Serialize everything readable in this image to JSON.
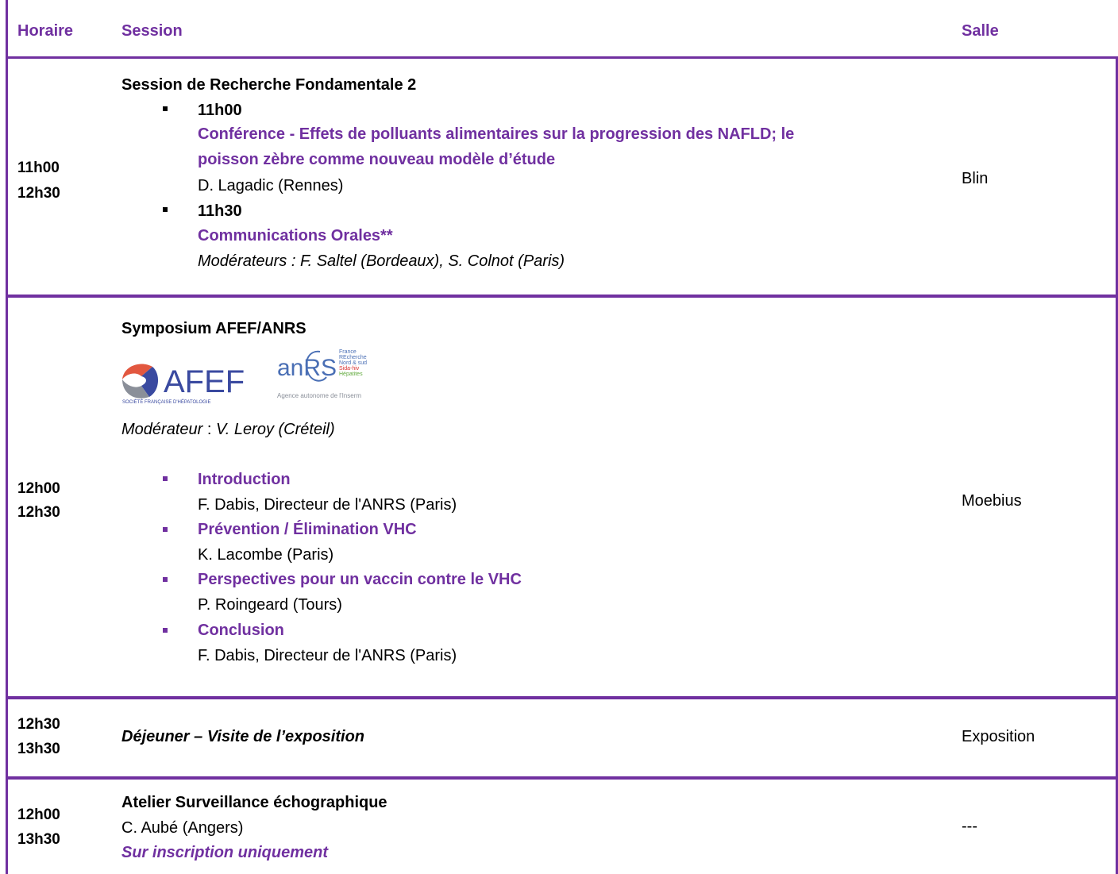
{
  "header": {
    "time_label": "Horaire",
    "session_label": "Session",
    "room_label": "Salle"
  },
  "rows": [
    {
      "time_start": "11h00",
      "time_end": "12h30",
      "room": "Blin",
      "title": "Session de Recherche Fondamentale 2",
      "items": [
        {
          "time": "11h00",
          "title_line1": "Conférence - Effets de polluants alimentaires sur la progression des NAFLD; le",
          "title_line2": "poisson zèbre comme nouveau modèle d’étude",
          "speaker": "D. Lagadic (Rennes)"
        },
        {
          "time": "11h30",
          "title": "Communications Orales**",
          "moderators": "Modérateurs : F. Saltel (Bordeaux), S. Colnot (Paris)"
        }
      ]
    },
    {
      "time_start": "12h00",
      "time_end": "12h30",
      "room": "Moebius",
      "title": "Symposium AFEF/ANRS",
      "logos": {
        "afef": {
          "name": "AFEF",
          "tagline": "SOCIÉTÉ FRANÇAISE D'HÉPATOLOGIE"
        },
        "anrs": {
          "name": "anRS",
          "lines": [
            "France",
            "REcherche",
            "Nord & sud",
            "Sida-hiv",
            "Hépatites"
          ],
          "agency": "Agence autonome de l'Inserm"
        }
      },
      "moderator_label": "Modérateur",
      "moderator_sep": " : ",
      "moderator_name": "V. Leroy (Créteil)",
      "items": [
        {
          "title": "Introduction",
          "speaker": "F. Dabis, Directeur de l'ANRS (Paris)"
        },
        {
          "title": "Prévention / Élimination VHC",
          "speaker": "K. Lacombe (Paris)"
        },
        {
          "title": "Perspectives pour un vaccin contre le VHC",
          "speaker": "P. Roingeard (Tours)"
        },
        {
          "title": "Conclusion",
          "speaker": "F. Dabis, Directeur de l'ANRS (Paris)"
        }
      ]
    },
    {
      "time_start": "12h30",
      "time_end": "13h30",
      "room": "Exposition",
      "title": "Déjeuner – Visite de l’exposition"
    },
    {
      "time_start": "12h00",
      "time_end": "13h30",
      "room": "---",
      "title": "Atelier Surveillance échographique",
      "speaker": "C. Aubé (Angers)",
      "note": "Sur inscription uniquement"
    }
  ],
  "colors": {
    "accent": "#7030a0",
    "afef_red": "#e2573f",
    "afef_gray": "#8a8f99",
    "afef_blue": "#3a4aa0",
    "anrs_blue": "#4a6fb5",
    "anrs_red": "#d9302f",
    "anrs_green": "#5fa83a"
  }
}
